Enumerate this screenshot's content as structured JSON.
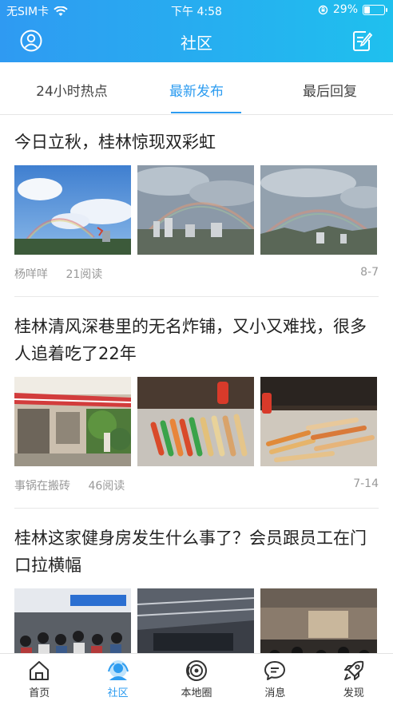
{
  "status_bar": {
    "carrier": "无SIM卡",
    "time": "下午 4:58",
    "battery": "29%",
    "battery_level": 0.29
  },
  "nav": {
    "title": "社区",
    "left_icon": "user-icon",
    "right_icon": "edit-icon"
  },
  "tabs": [
    {
      "label": "24小时热点",
      "active": false
    },
    {
      "label": "最新发布",
      "active": true
    },
    {
      "label": "最后回复",
      "active": false
    }
  ],
  "posts": [
    {
      "title": "今日立秋，桂林惊现双彩虹",
      "author": "杨咩咩",
      "reads": "21阅读",
      "date": "8-7"
    },
    {
      "title": "桂林清风深巷里的无名炸铺，又小又难找，很多人追着吃了22年",
      "author": "事锅在搬砖",
      "reads": "46阅读",
      "date": "7-14"
    },
    {
      "title": "桂林这家健身房发生什么事了？会员跟员工在门口拉横幅",
      "author": "",
      "reads": "",
      "date": ""
    }
  ],
  "tabbar": [
    {
      "label": "首页",
      "icon": "home-icon",
      "active": false
    },
    {
      "label": "社区",
      "icon": "community-icon",
      "active": true
    },
    {
      "label": "本地圈",
      "icon": "local-circle-icon",
      "active": false
    },
    {
      "label": "消息",
      "icon": "message-icon",
      "active": false
    },
    {
      "label": "发现",
      "icon": "rocket-icon",
      "active": false
    }
  ],
  "colors": {
    "accent": "#2d9cf0",
    "header_start": "#2f9af2",
    "header_end": "#1fc0ee"
  }
}
